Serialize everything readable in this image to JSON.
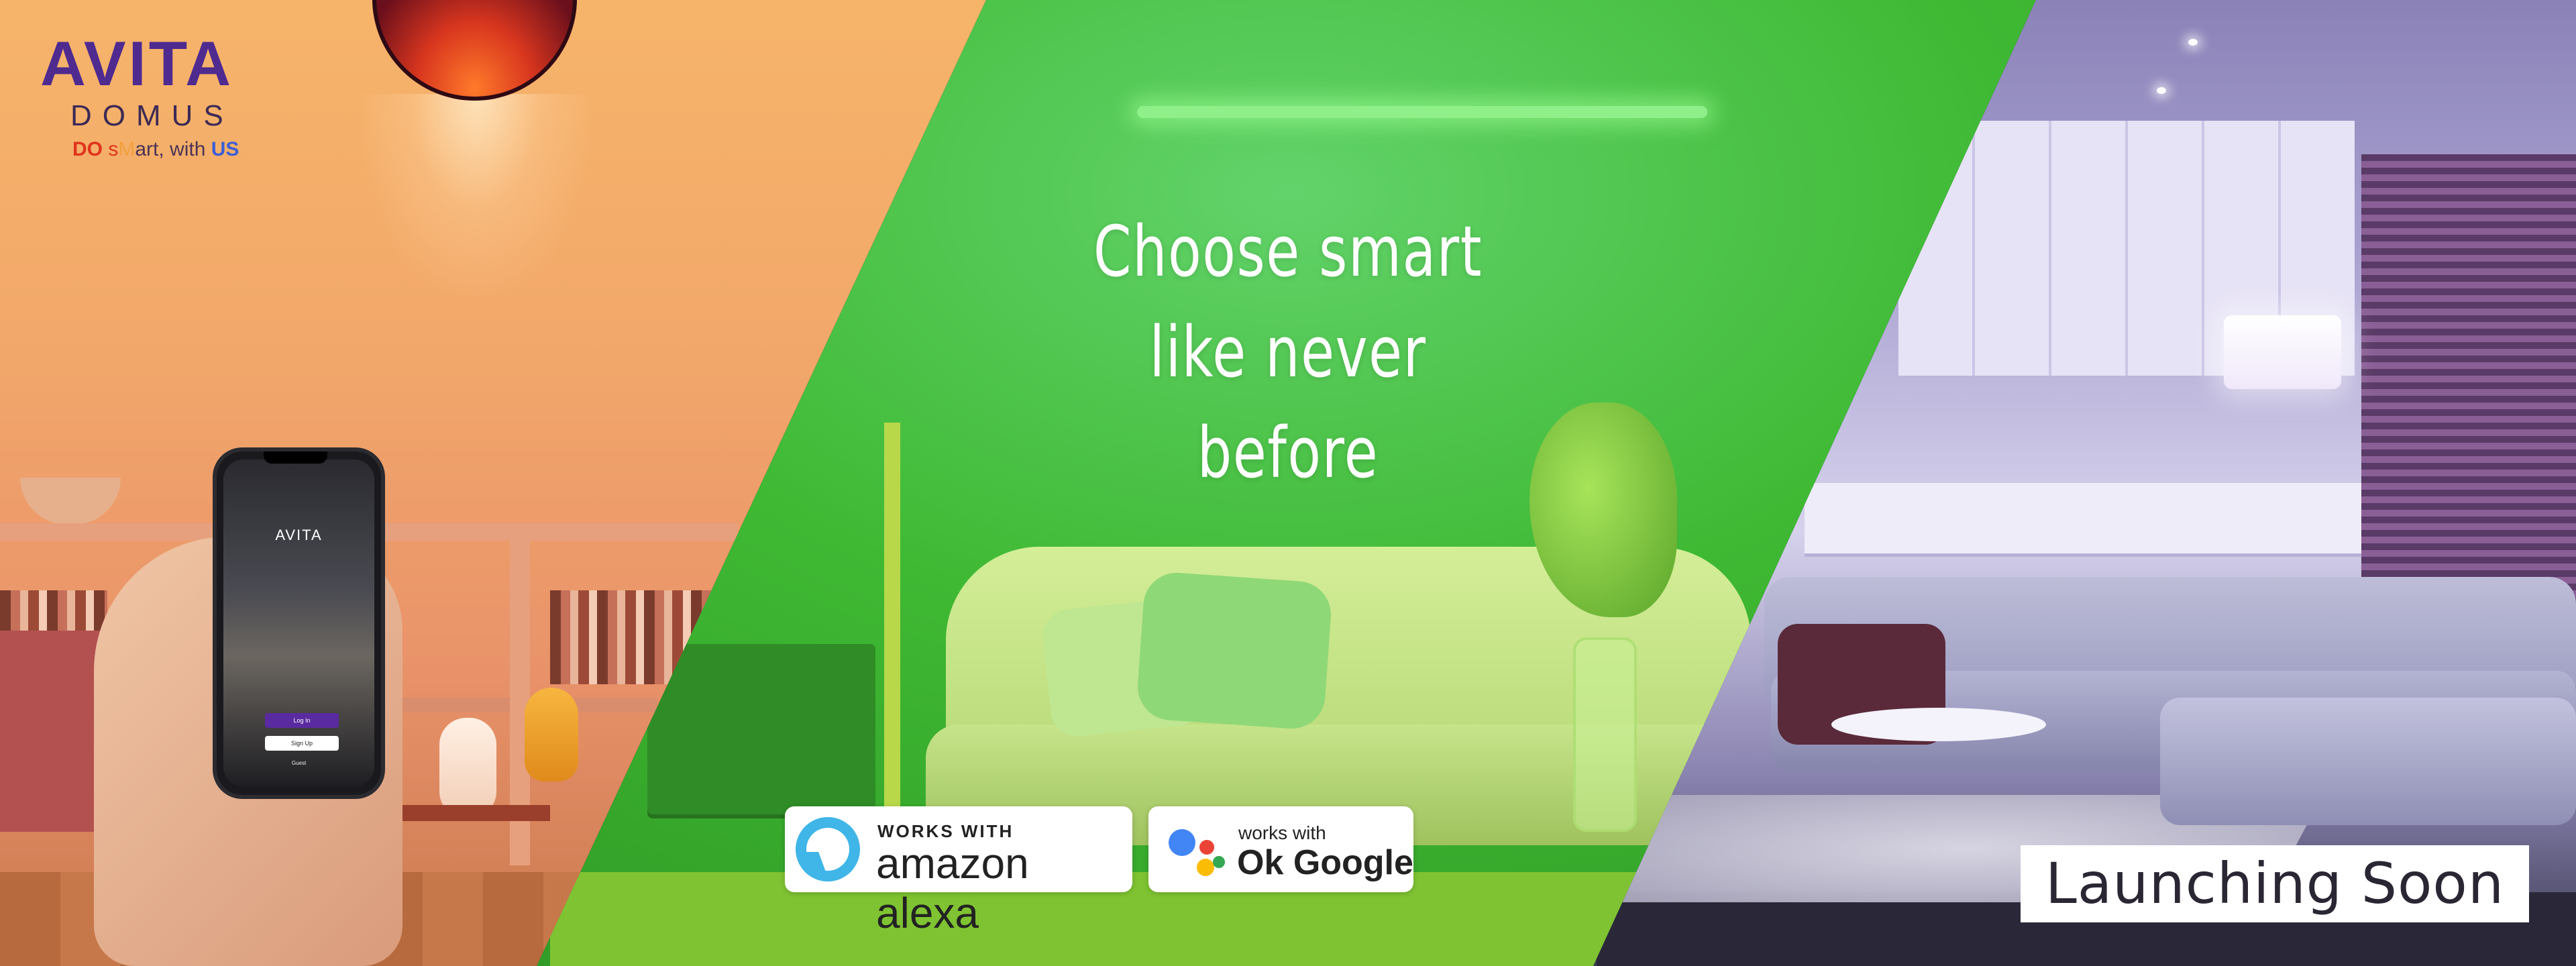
{
  "brand": {
    "name": "AVITA",
    "sub": "DOMUS",
    "tagline": "DO sMart, with US",
    "tagline_parts": [
      "DO",
      " ",
      "s",
      "M",
      "art, with ",
      "US"
    ]
  },
  "phone_screen": {
    "logo": "AVITA",
    "login_button": "Log In",
    "signup_button": "Sign Up",
    "guest_link": "Guest"
  },
  "headline": {
    "line1": "Choose smart",
    "line2": "like never before"
  },
  "badges": {
    "alexa": {
      "top_text": "WORKS WITH",
      "name": "amazon alexa",
      "icon": "alexa-ring-icon"
    },
    "google": {
      "top_text": "works with",
      "name": "Ok Google",
      "icon": "google-assistant-dots-icon"
    }
  },
  "cta": {
    "label": "Launching Soon"
  },
  "colors": {
    "brand_purple": "#4f2a8f",
    "accent_orange": "#f6b46a",
    "accent_green": "#3fb934",
    "accent_lilac": "#a7a0cf",
    "alexa_blue": "#3fb5e8"
  }
}
